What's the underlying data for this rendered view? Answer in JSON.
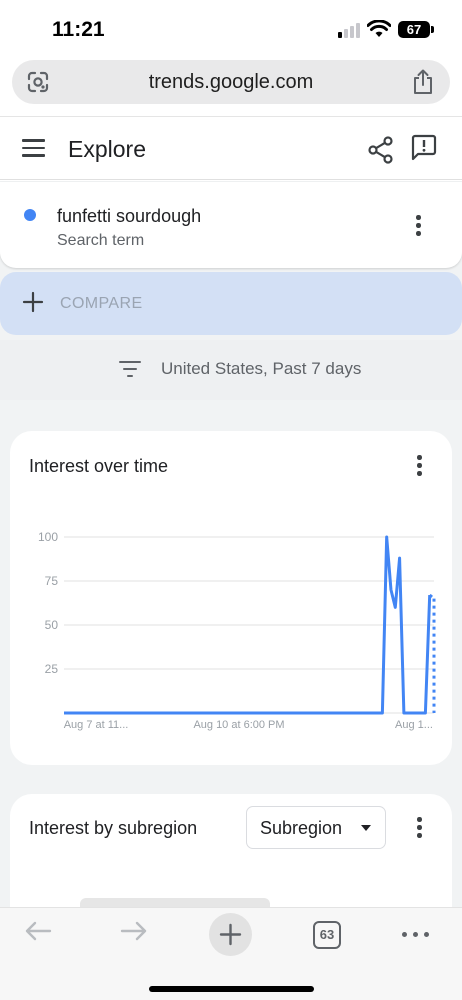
{
  "status_bar": {
    "time": "11:21",
    "battery": "67"
  },
  "browser": {
    "url": "trends.google.com"
  },
  "header": {
    "title": "Explore"
  },
  "search_term": {
    "name": "funfetti sourdough",
    "subtitle": "Search term",
    "color": "#4285f4"
  },
  "compare": {
    "label": "COMPARE"
  },
  "filter": {
    "text": "United States, Past 7 days"
  },
  "interest_over_time": {
    "title": "Interest over time",
    "chart_data": {
      "type": "line",
      "title": "Interest over time",
      "x_tick_labels": [
        "Aug 7 at 11...",
        "Aug 10 at 6:00 PM",
        "Aug 1..."
      ],
      "y_ticks": [
        25,
        50,
        75,
        100
      ],
      "ylim": [
        0,
        100
      ],
      "grid": true,
      "series": [
        {
          "name": "funfetti sourdough",
          "color": "#4285f4",
          "values": [
            0,
            0,
            0,
            0,
            0,
            0,
            0,
            0,
            0,
            0,
            0,
            0,
            0,
            0,
            0,
            0,
            0,
            0,
            0,
            0,
            0,
            0,
            0,
            0,
            0,
            0,
            0,
            0,
            0,
            0,
            0,
            0,
            0,
            0,
            0,
            0,
            0,
            0,
            0,
            0,
            0,
            0,
            0,
            0,
            0,
            0,
            0,
            0,
            0,
            0,
            0,
            0,
            0,
            0,
            0,
            0,
            0,
            0,
            0,
            0,
            0,
            0,
            0,
            0,
            0,
            0,
            0,
            0,
            0,
            0,
            0,
            0,
            0,
            0,
            0,
            100,
            70,
            60,
            88,
            0,
            0,
            0,
            0,
            0,
            0,
            67,
            65
          ]
        }
      ],
      "partial_last_segment": true
    }
  },
  "interest_by_subregion": {
    "title": "Interest by subregion",
    "select_value": "Subregion"
  },
  "toolbar": {
    "tab_count": "63"
  }
}
